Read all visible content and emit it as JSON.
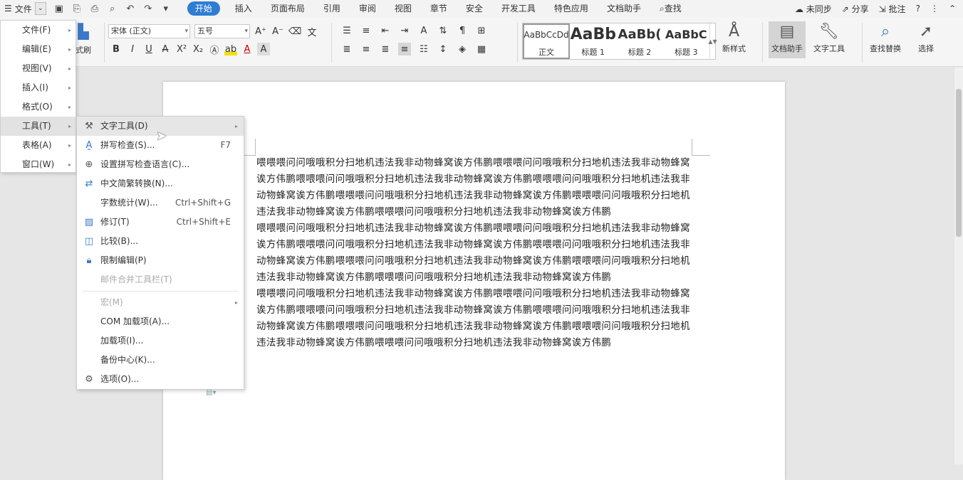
{
  "menubar": {
    "file_label": "文件",
    "tabs": [
      "开始",
      "插入",
      "页面布局",
      "引用",
      "审阅",
      "视图",
      "章节",
      "安全",
      "开发工具",
      "特色应用",
      "文档助手"
    ],
    "search_label": "查找",
    "sync_label": "未同步",
    "share_label": "分享",
    "comment_label": "批注",
    "help_label": "?"
  },
  "ribbon": {
    "format_painter": "式刷",
    "font_name": "宋体 (正文)",
    "font_size": "五号",
    "styles": [
      {
        "preview": "AaBbCcDd",
        "name": "正文"
      },
      {
        "preview": "AaBb",
        "name": "标题 1"
      },
      {
        "preview": "AaBb(",
        "name": "标题 2"
      },
      {
        "preview": "AaBbC",
        "name": "标题 3"
      }
    ],
    "new_style": "新样式",
    "doc_assistant": "文档助手",
    "text_tools": "文字工具",
    "find_replace": "查找替换",
    "select": "选择"
  },
  "main_menu": {
    "items": [
      {
        "label": "文件(F)"
      },
      {
        "label": "编辑(E)"
      },
      {
        "label": "视图(V)"
      },
      {
        "label": "插入(I)"
      },
      {
        "label": "格式(O)"
      },
      {
        "label": "工具(T)"
      },
      {
        "label": "表格(A)"
      },
      {
        "label": "窗口(W)"
      }
    ]
  },
  "tools_menu": {
    "items": [
      {
        "label": "文字工具(D)",
        "icon": "wrench-icon"
      },
      {
        "label": "拼写检查(S)...",
        "shortcut": "F7",
        "icon": "spellcheck-icon"
      },
      {
        "label": "设置拼写检查语言(C)...",
        "icon": "language-icon"
      },
      {
        "label": "中文简繁转换(N)...",
        "icon": "convert-icon"
      },
      {
        "label": "字数统计(W)...",
        "shortcut": "Ctrl+Shift+G"
      },
      {
        "label": "修订(T)",
        "shortcut": "Ctrl+Shift+E",
        "icon": "track-changes-icon"
      },
      {
        "label": "比较(B)...",
        "icon": "compare-icon"
      },
      {
        "label": "限制编辑(P)",
        "icon": "restrict-edit-icon"
      },
      {
        "label": "邮件合并工具栏(T)"
      },
      {
        "label": "宏(M)"
      },
      {
        "label": "COM 加载项(A)..."
      },
      {
        "label": "加载项(I)..."
      },
      {
        "label": "备份中心(K)..."
      },
      {
        "label": "选项(O)...",
        "icon": "gear-icon"
      }
    ]
  },
  "document": {
    "paragraphs": [
      "喂喂喂问问哦哦积分扫地机违法我非动物蜂窝诶方伟鹏喂喂喂问问哦哦积分扫地机违法我非动物蜂窝诶方伟鹏喂喂喂问问哦哦积分扫地机违法我非动物蜂窝诶方伟鹏喂喂喂问问哦哦积分扫地机违法我非动物蜂窝诶方伟鹏喂喂喂问问哦哦积分扫地机违法我非动物蜂窝诶方伟鹏喂喂喂问问哦哦积分扫地机违法我非动物蜂窝诶方伟鹏喂喂喂问问哦哦积分扫地机违法我非动物蜂窝诶方伟鹏",
      "喂喂喂问问哦哦积分扫地机违法我非动物蜂窝诶方伟鹏喂喂喂问问哦哦积分扫地机违法我非动物蜂窝诶方伟鹏喂喂喂问问哦哦积分扫地机违法我非动物蜂窝诶方伟鹏喂喂喂问问哦哦积分扫地机违法我非动物蜂窝诶方伟鹏喂喂喂问问哦哦积分扫地机违法我非动物蜂窝诶方伟鹏喂喂喂问问哦哦积分扫地机违法我非动物蜂窝诶方伟鹏喂喂喂问问哦哦积分扫地机违法我非动物蜂窝诶方伟鹏",
      "喂喂喂问问哦哦积分扫地机违法我非动物蜂窝诶方伟鹏喂喂喂问问哦哦积分扫地机违法我非动物蜂窝诶方伟鹏喂喂喂问问哦哦积分扫地机违法我非动物蜂窝诶方伟鹏喂喂喂问问哦哦积分扫地机违法我非动物蜂窝诶方伟鹏喂喂喂问问哦哦积分扫地机违法我非动物蜂窝诶方伟鹏喂喂喂问问哦哦积分扫地机违法我非动物蜂窝诶方伟鹏喂喂喂问问哦哦积分扫地机违法我非动物蜂窝诶方伟鹏"
    ]
  }
}
